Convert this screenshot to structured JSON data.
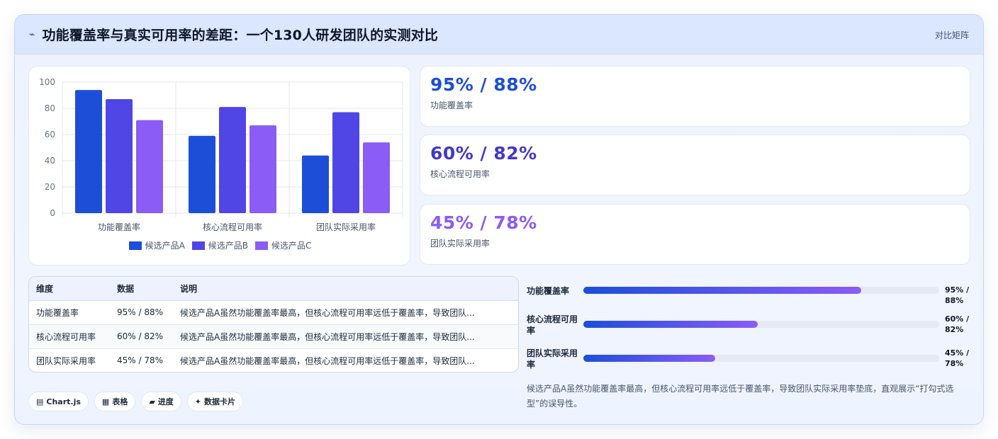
{
  "header": {
    "icon": "pulse-icon",
    "title": "功能覆盖率与真实可用率的差距：一个130人研发团队的实测对比",
    "right_label": "对比矩阵"
  },
  "chart_data": {
    "type": "bar",
    "categories": [
      "功能覆盖率",
      "核心流程可用率",
      "团队实际采用率"
    ],
    "series": [
      {
        "name": "候选产品A",
        "values": [
          94,
          59,
          44
        ],
        "color": "#1d4ed8"
      },
      {
        "name": "候选产品B",
        "values": [
          87,
          81,
          77
        ],
        "color": "#4f46e5"
      },
      {
        "name": "候选产品C",
        "values": [
          71,
          67,
          54
        ],
        "color": "#8b5cf6"
      }
    ],
    "ylim": [
      0,
      100
    ],
    "yticks": [
      "0",
      "20",
      "40",
      "60",
      "80",
      "100"
    ],
    "grid": true,
    "legend_position": "bottom"
  },
  "kpis": [
    {
      "value": "95% / 88%",
      "label": "功能覆盖率",
      "color": "#1d4ed8"
    },
    {
      "value": "60% / 82%",
      "label": "核心流程可用率",
      "color": "#4338ca"
    },
    {
      "value": "45% / 78%",
      "label": "团队实际采用率",
      "color": "#8b5cf6"
    }
  ],
  "table": {
    "headers": [
      "维度",
      "数据",
      "说明"
    ],
    "rows": [
      [
        "功能覆盖率",
        "95% / 88%",
        "候选产品A虽然功能覆盖率最高，但核心流程可用率远低于覆盖率，导致团队..."
      ],
      [
        "核心流程可用率",
        "60% / 82%",
        "候选产品A虽然功能覆盖率最高，但核心流程可用率远低于覆盖率，导致团队..."
      ],
      [
        "团队实际采用率",
        "45% / 78%",
        "候选产品A虽然功能覆盖率最高，但核心流程可用率远低于覆盖率，导致团队..."
      ]
    ]
  },
  "progress": [
    {
      "label": "功能覆盖率",
      "fraction": 0.78,
      "value": "95% / 88%"
    },
    {
      "label": "核心流程可用率",
      "fraction": 0.49,
      "value": "60% / 82%"
    },
    {
      "label": "团队实际采用率",
      "fraction": 0.37,
      "value": "45% / 78%"
    }
  ],
  "note": "候选产品A虽然功能覆盖率最高，但核心流程可用率远低于覆盖率，导致团队实际采用率垫底，直观展示“打勾式选型”的误导性。",
  "chips": [
    {
      "icon": "chart-icon",
      "glyph": "▤",
      "label": "Chart.js"
    },
    {
      "icon": "table-icon",
      "glyph": "▦",
      "label": "表格"
    },
    {
      "icon": "progress-icon",
      "glyph": "▰",
      "label": "进度"
    },
    {
      "icon": "sparkle-icon",
      "glyph": "✦",
      "label": "数据卡片"
    }
  ]
}
